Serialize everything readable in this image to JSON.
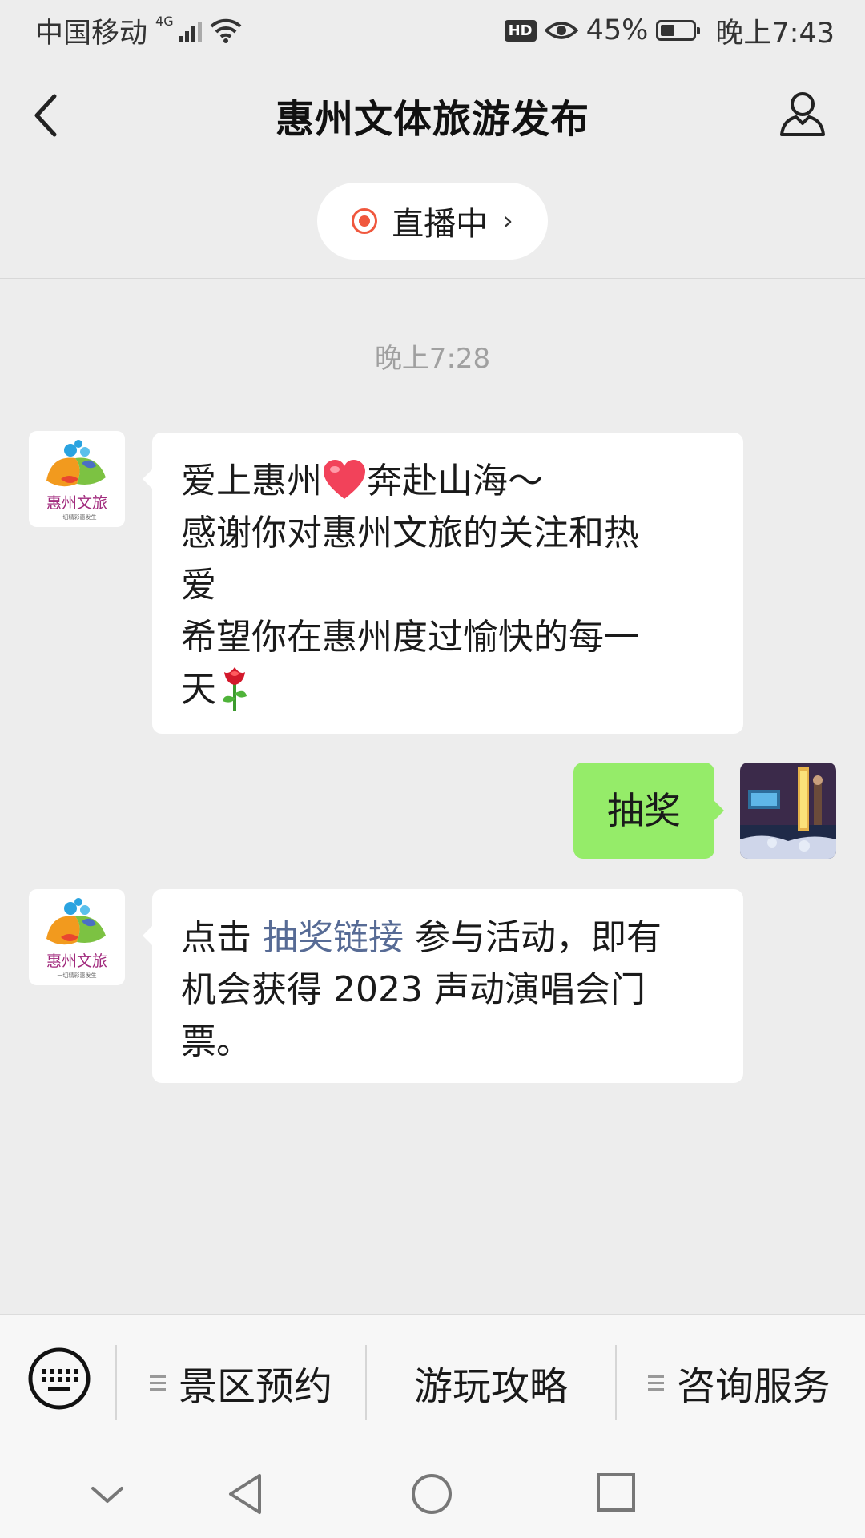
{
  "status_bar": {
    "carrier": "中国移动",
    "network": "4G",
    "hd": "HD",
    "battery_percent_text": "45%",
    "battery_level": 0.45,
    "time": "晚上7:43"
  },
  "nav": {
    "title": "惠州文体旅游发布",
    "back_icon": "back-chevron-icon",
    "profile_icon": "person-icon"
  },
  "live": {
    "label": "直播中",
    "chevron": "›",
    "accent": "#f0573d"
  },
  "chat": {
    "timestamp": "晚上7:28",
    "messages": [
      {
        "from": "official",
        "lines": {
          "l1a": "爱上惠州",
          "l1b": "奔赴山海～",
          "l2": "感谢你对惠州文旅的关注和热",
          "l3": "爱",
          "l4": "希望你在惠州度过愉快的每一",
          "l5": "天"
        },
        "emoji": [
          "heart-emoji",
          "rose-emoji"
        ]
      },
      {
        "from": "me",
        "text": "抽奖"
      },
      {
        "from": "official",
        "prefix": "点击 ",
        "link": "抽奖链接",
        "suffix": " 参与活动，即有",
        "line2": "机会获得 2023 声动演唱会门",
        "line3": "票。"
      }
    ],
    "official_avatar_text": "惠州文旅",
    "official_avatar_sub": "一切精彩惠发生"
  },
  "menu": {
    "items": [
      "景区预约",
      "游玩攻略",
      "咨询服务"
    ],
    "keyboard_icon": "keyboard-icon"
  },
  "system_nav": [
    "down-chevron-icon",
    "back-triangle-icon",
    "home-circle-icon",
    "recents-square-icon"
  ],
  "colors": {
    "background": "#ededed",
    "bubble_self": "#95ec69",
    "link": "#576b95"
  }
}
